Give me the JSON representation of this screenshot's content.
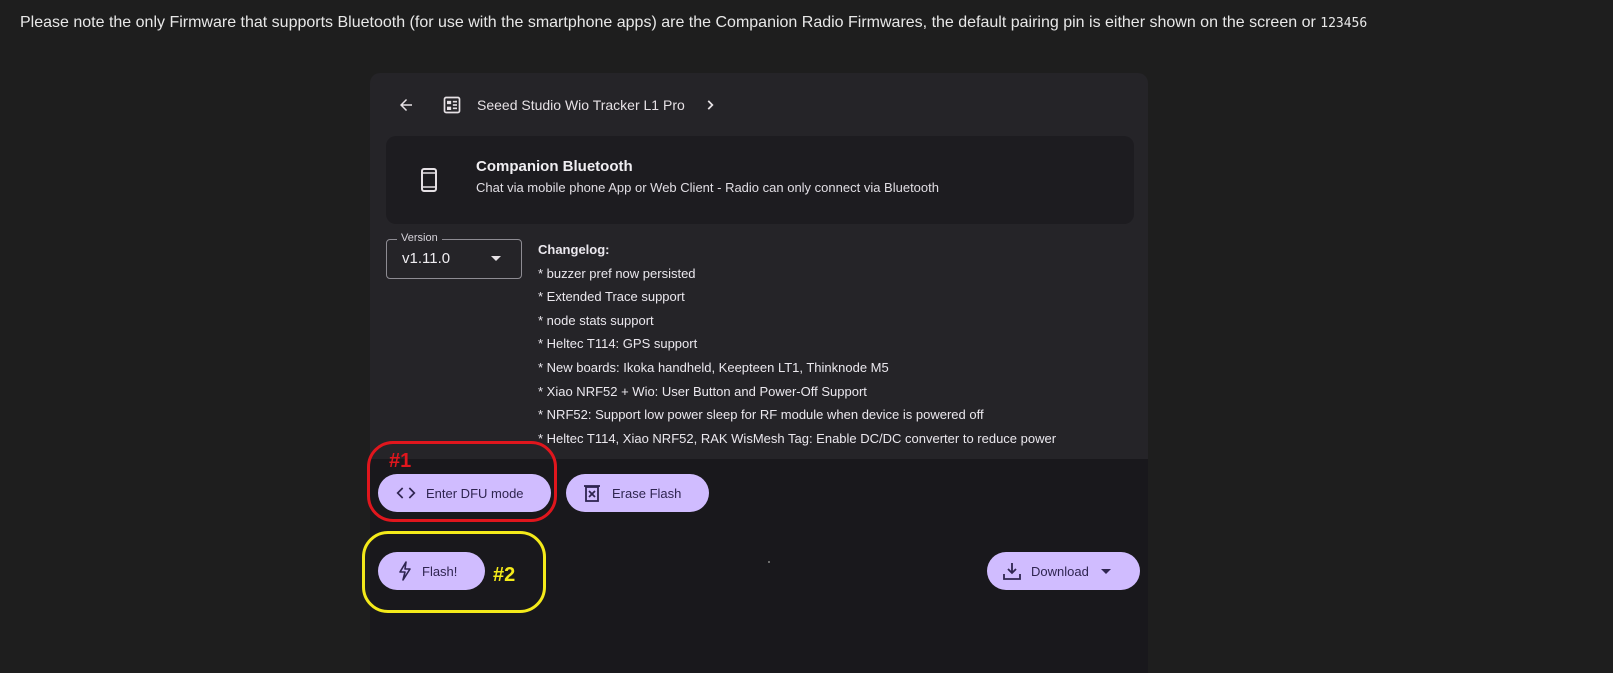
{
  "notice": {
    "text": "Please note the only Firmware that supports Bluetooth (for use with the smartphone apps) are the Companion Radio Firmwares, the default pairing pin is either shown on the screen or ",
    "pin": "123456"
  },
  "breadcrumb": {
    "back_icon": "arrow-left-icon",
    "board_icon": "board-icon",
    "board_name": "Seeed Studio Wio Tracker L1 Pro",
    "next_icon": "chevron-right-icon"
  },
  "firmware": {
    "icon": "smartphone-icon",
    "title": "Companion Bluetooth",
    "description": "Chat via mobile phone App or Web Client - Radio can only connect via Bluetooth"
  },
  "version": {
    "label": "Version",
    "value": "v1.11.0"
  },
  "changelog": {
    "title": "Changelog:",
    "items": [
      "* buzzer pref now persisted",
      "* Extended Trace support",
      "* node stats support",
      "* Heltec T114: GPS support",
      "* New boards: Ikoka handheld, Keepteen LT1, Thinknode M5",
      "* Xiao NRF52 + Wio: User Button and Power-Off Support",
      "* NRF52: Support low power sleep for RF module when device is powered off",
      "* Heltec T114, Xiao NRF52, RAK WisMesh Tag: Enable DC/DC converter to reduce power"
    ]
  },
  "actions": {
    "dfu_label": "Enter DFU mode",
    "erase_label": "Erase Flash",
    "flash_label": "Flash!",
    "download_label": "Download"
  },
  "annotations": {
    "label_1": "#1",
    "label_2": "#2",
    "color_1": "#e0161d",
    "color_2": "#f4ea1a"
  },
  "colors": {
    "accent": "#d0bcff",
    "panel": "#252428",
    "background": "#1e1e1e"
  }
}
